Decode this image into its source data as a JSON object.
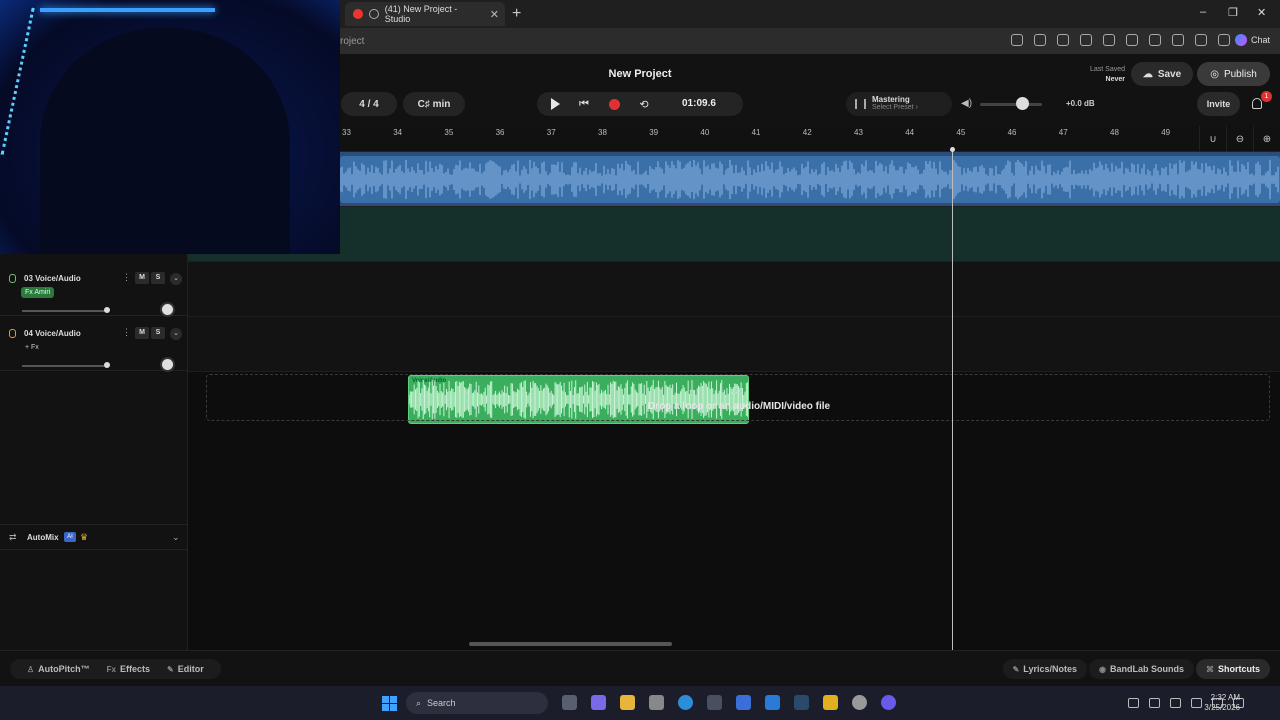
{
  "browser": {
    "tab_title": "(41) New Project - Studio",
    "url_fragment": "roject",
    "chat_label": "Chat",
    "window_controls": [
      "–",
      "❐",
      "✕"
    ]
  },
  "header": {
    "project_title": "New Project",
    "time_signature": "4 / 4",
    "key": "C♯ min",
    "time": "01:09.6",
    "mastering_label": "Mastering",
    "mastering_sub": "Select Preset ›",
    "volume_db": "+0.0 dB",
    "volume_level": 0.7,
    "last_saved_label": "Last Saved",
    "last_saved_value": "Never",
    "save_label": "Save",
    "publish_label": "Publish",
    "invite_label": "Invite",
    "notification_count": "1"
  },
  "ruler": {
    "ticks": [
      "33",
      "34",
      "35",
      "36",
      "37",
      "38",
      "39",
      "40",
      "41",
      "42",
      "43",
      "44",
      "45",
      "46",
      "47",
      "48",
      "49"
    ]
  },
  "tracks": [
    {
      "name": "03 Voice/Audio",
      "fx": "Fx Amiri",
      "mute": "M",
      "solo": "S"
    },
    {
      "name": "04 Voice/Audio",
      "fx": "+ Fx",
      "mute": "M",
      "solo": "S"
    }
  ],
  "clips": {
    "green_label": "Voice/Audio"
  },
  "automix": {
    "label": "AutoMix",
    "badge": "AI"
  },
  "dropzone": {
    "text": "Drop a loop or an audio/MIDI/video file"
  },
  "bottombar": {
    "left": [
      {
        "icon": "♙",
        "label": "AutoPitch™"
      },
      {
        "icon": "Fx",
        "label": "Effects"
      },
      {
        "icon": "✎",
        "label": "Editor"
      }
    ],
    "right": [
      {
        "icon": "✎",
        "label": "Lyrics/Notes"
      },
      {
        "icon": "◉",
        "label": "BandLab Sounds"
      },
      {
        "icon": "⌘",
        "label": "Shortcuts"
      }
    ]
  },
  "taskbar": {
    "search_placeholder": "Search",
    "time": "2:32 AM",
    "date": "3/25/2026"
  },
  "colors": {
    "record": "#e23030",
    "track_blue": "#3a6fa8",
    "track_green": "#3bae5d"
  }
}
